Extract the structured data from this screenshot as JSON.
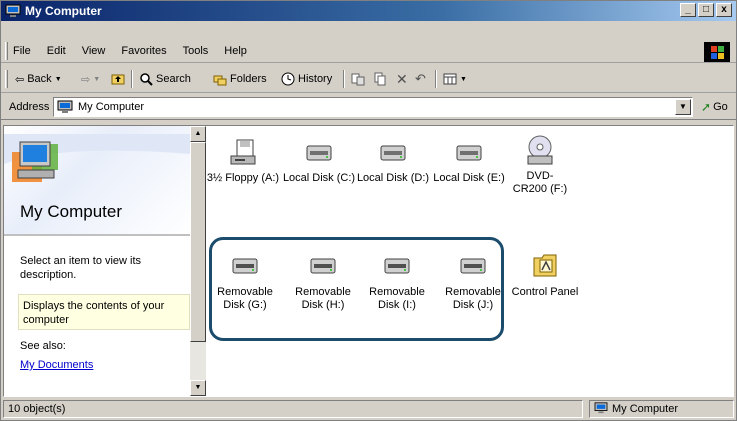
{
  "window": {
    "title": "My Computer"
  },
  "menu": {
    "items": [
      {
        "label": "File"
      },
      {
        "label": "Edit"
      },
      {
        "label": "View"
      },
      {
        "label": "Favorites"
      },
      {
        "label": "Tools"
      },
      {
        "label": "Help"
      }
    ]
  },
  "toolbar": {
    "back_label": "Back",
    "search_label": "Search",
    "folders_label": "Folders",
    "history_label": "History"
  },
  "address": {
    "label": "Address",
    "value": "My Computer",
    "go_label": "Go"
  },
  "left_pane": {
    "title": "My Computer",
    "select_text": "Select an item to view its description.",
    "description": "Displays the contents of your computer",
    "see_also": "See also:",
    "link": "My Documents"
  },
  "files": {
    "items": [
      {
        "label": "3½ Floppy (A:)",
        "icon": "floppy-drive-icon"
      },
      {
        "label": "Local Disk (C:)",
        "icon": "hard-disk-icon"
      },
      {
        "label": "Local Disk (D:)",
        "icon": "hard-disk-icon"
      },
      {
        "label": "Local Disk (E:)",
        "icon": "hard-disk-icon"
      },
      {
        "label": "DVD-CR200 (F:)",
        "icon": "cd-drive-icon"
      },
      {
        "label": "Removable Disk (G:)",
        "icon": "removable-disk-icon"
      },
      {
        "label": "Removable Disk (H:)",
        "icon": "removable-disk-icon"
      },
      {
        "label": "Removable Disk (I:)",
        "icon": "removable-disk-icon"
      },
      {
        "label": "Removable Disk (J:)",
        "icon": "removable-disk-icon"
      },
      {
        "label": "Control Panel",
        "icon": "control-panel-icon"
      }
    ]
  },
  "status": {
    "left": "10 object(s)",
    "right": "My Computer"
  },
  "colors": {
    "title_start": "#0a246a",
    "title_end": "#a6caf0",
    "highlight_border": "#1b4c6c",
    "chrome": "#d4d0c8",
    "link": "#0000cc"
  }
}
